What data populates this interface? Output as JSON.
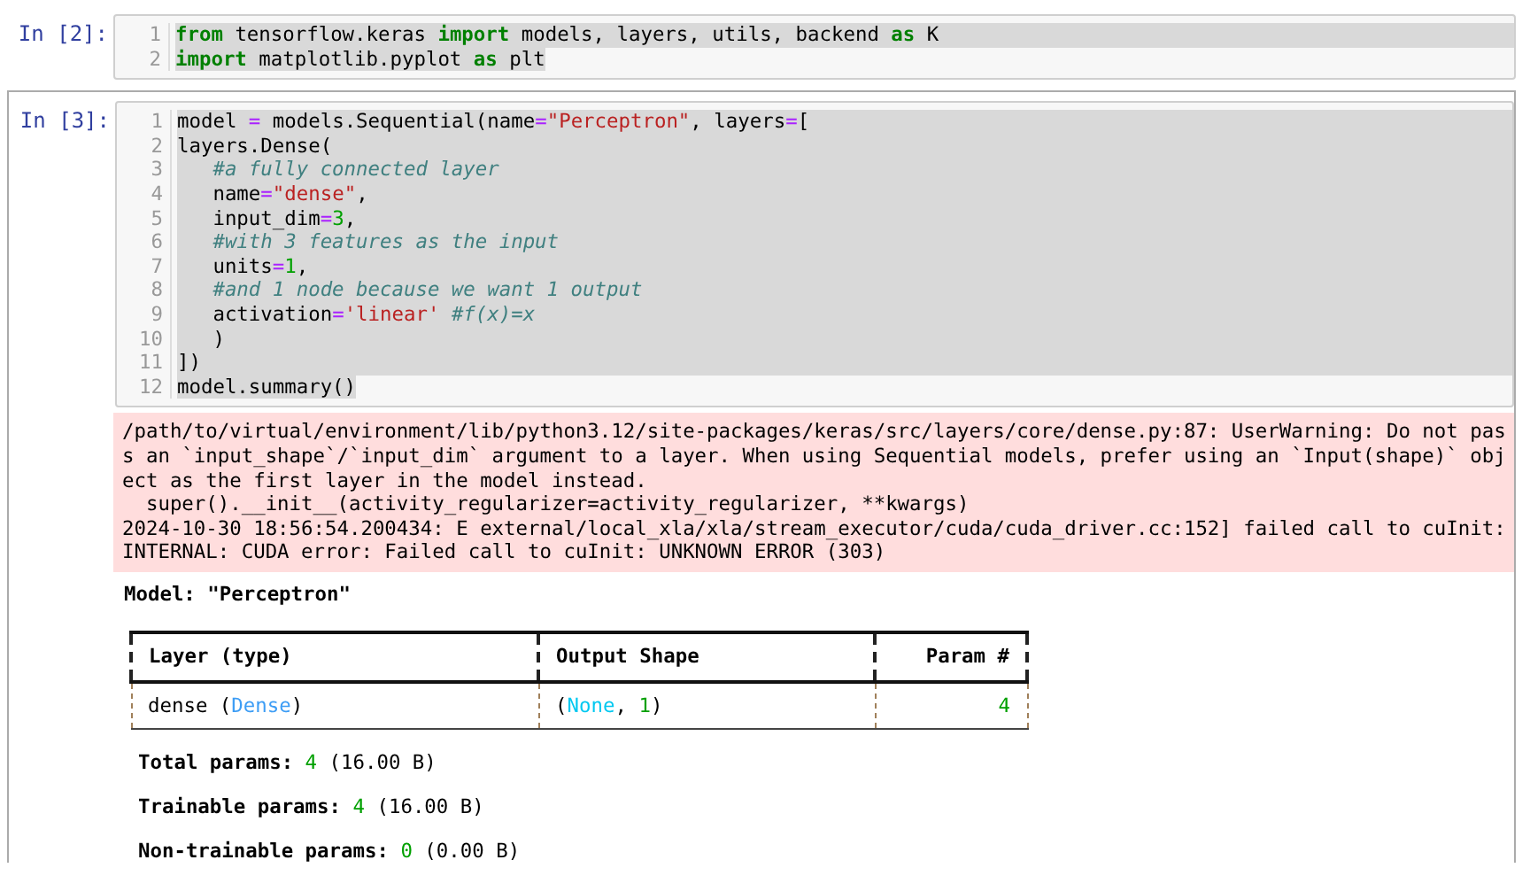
{
  "cells": [
    {
      "prompt": "In [2]:",
      "selection": true,
      "lines": [
        [
          {
            "kind": "kw",
            "text": "from"
          },
          {
            "kind": "plain",
            "text": " tensorflow.keras "
          },
          {
            "kind": "kw",
            "text": "import"
          },
          {
            "kind": "plain",
            "text": " models, layers, utils, backend "
          },
          {
            "kind": "kw",
            "text": "as"
          },
          {
            "kind": "plain",
            "text": " K"
          }
        ],
        [
          {
            "kind": "kw",
            "text": "import"
          },
          {
            "kind": "plain",
            "text": " matplotlib.pyplot "
          },
          {
            "kind": "kw",
            "text": "as"
          },
          {
            "kind": "plain",
            "text": " plt"
          }
        ]
      ],
      "line_numbers": [
        "1",
        "2"
      ]
    },
    {
      "prompt": "In [3]:",
      "selection": true,
      "lines": [
        [
          {
            "kind": "plain",
            "text": "model "
          },
          {
            "kind": "op",
            "text": "="
          },
          {
            "kind": "plain",
            "text": " models.Sequential(name"
          },
          {
            "kind": "op",
            "text": "="
          },
          {
            "kind": "str",
            "text": "\"Perceptron\""
          },
          {
            "kind": "plain",
            "text": ", layers"
          },
          {
            "kind": "op",
            "text": "="
          },
          {
            "kind": "plain",
            "text": "["
          }
        ],
        [
          {
            "kind": "plain",
            "text": "layers.Dense("
          }
        ],
        {
          "indented": true,
          "tokens": [
            {
              "kind": "comment",
              "text": "#a fully connected layer"
            }
          ]
        },
        [
          {
            "kind": "plain",
            "text": "   name"
          },
          {
            "kind": "op",
            "text": "="
          },
          {
            "kind": "str",
            "text": "\"dense\""
          },
          {
            "kind": "plain",
            "text": ","
          }
        ],
        [
          {
            "kind": "plain",
            "text": "   input_dim"
          },
          {
            "kind": "op",
            "text": "="
          },
          {
            "kind": "num",
            "text": "3"
          },
          {
            "kind": "plain",
            "text": ","
          }
        ],
        {
          "indented": true,
          "tokens": [
            {
              "kind": "comment",
              "text": "#with 3 features as the input"
            }
          ]
        },
        [
          {
            "kind": "plain",
            "text": "   units"
          },
          {
            "kind": "op",
            "text": "="
          },
          {
            "kind": "num",
            "text": "1"
          },
          {
            "kind": "plain",
            "text": ","
          }
        ],
        {
          "indented": true,
          "tokens": [
            {
              "kind": "comment",
              "text": "#and 1 node because we want 1 output"
            }
          ]
        },
        [
          {
            "kind": "plain",
            "text": "   activation"
          },
          {
            "kind": "op",
            "text": "="
          },
          {
            "kind": "str",
            "text": "'linear'"
          },
          {
            "kind": "comment",
            "text": " #f(x)=x"
          }
        ],
        [
          {
            "kind": "plain",
            "text": "   )"
          }
        ],
        [
          {
            "kind": "plain",
            "text": "])"
          }
        ],
        [
          {
            "kind": "plain",
            "text": "model.summary()"
          }
        ]
      ],
      "line_numbers": [
        "1",
        "2",
        "3",
        "4",
        "5",
        "6",
        "7",
        "8",
        "9",
        "10",
        "11",
        "12"
      ],
      "stderr": [
        "/path/to/virtual/environment/lib/python3.12/site-packages/keras/src/layers/core/dense.py:87: UserWarning: Do not pas",
        "s an `input_shape`/`input_dim` argument to a layer. When using Sequential models, prefer using an `Input(shape)` obj",
        "ect as the first layer in the model instead.",
        "  super().__init__(activity_regularizer=activity_regularizer, **kwargs)",
        "2024-10-30 18:56:54.200434: E external/local_xla/xla/stream_executor/cuda/cuda_driver.cc:152] failed call to cuInit:",
        "INTERNAL: CUDA error: Failed call to cuInit: UNKNOWN ERROR (303)"
      ],
      "model_title": "Model: \"Perceptron\"",
      "table": {
        "columns": [
          "Layer (type)",
          "Output Shape",
          "Param #"
        ],
        "rows": [
          [
            [
              {
                "kind": "plain",
                "text": "dense ("
              },
              {
                "kind": "type",
                "text": "Dense"
              },
              {
                "kind": "plain",
                "text": ")"
              }
            ],
            [
              {
                "kind": "plain",
                "text": "("
              },
              {
                "kind": "none",
                "text": "None"
              },
              {
                "kind": "plain",
                "text": ", "
              },
              {
                "kind": "num",
                "text": "1"
              },
              {
                "kind": "plain",
                "text": ")"
              }
            ],
            [
              {
                "kind": "num",
                "text": "4"
              }
            ]
          ]
        ]
      },
      "params": [
        [
          {
            "kind": "bold",
            "text": "Total params: "
          },
          {
            "kind": "num",
            "text": "4"
          },
          {
            "kind": "plain",
            "text": " (16.00 B)"
          }
        ],
        [
          {
            "kind": "bold",
            "text": "Trainable params: "
          },
          {
            "kind": "num",
            "text": "4"
          },
          {
            "kind": "plain",
            "text": " (16.00 B)"
          }
        ],
        [
          {
            "kind": "bold",
            "text": "Non-trainable params: "
          },
          {
            "kind": "num",
            "text": "0"
          },
          {
            "kind": "plain",
            "text": " (0.00 B)"
          }
        ]
      ]
    }
  ]
}
